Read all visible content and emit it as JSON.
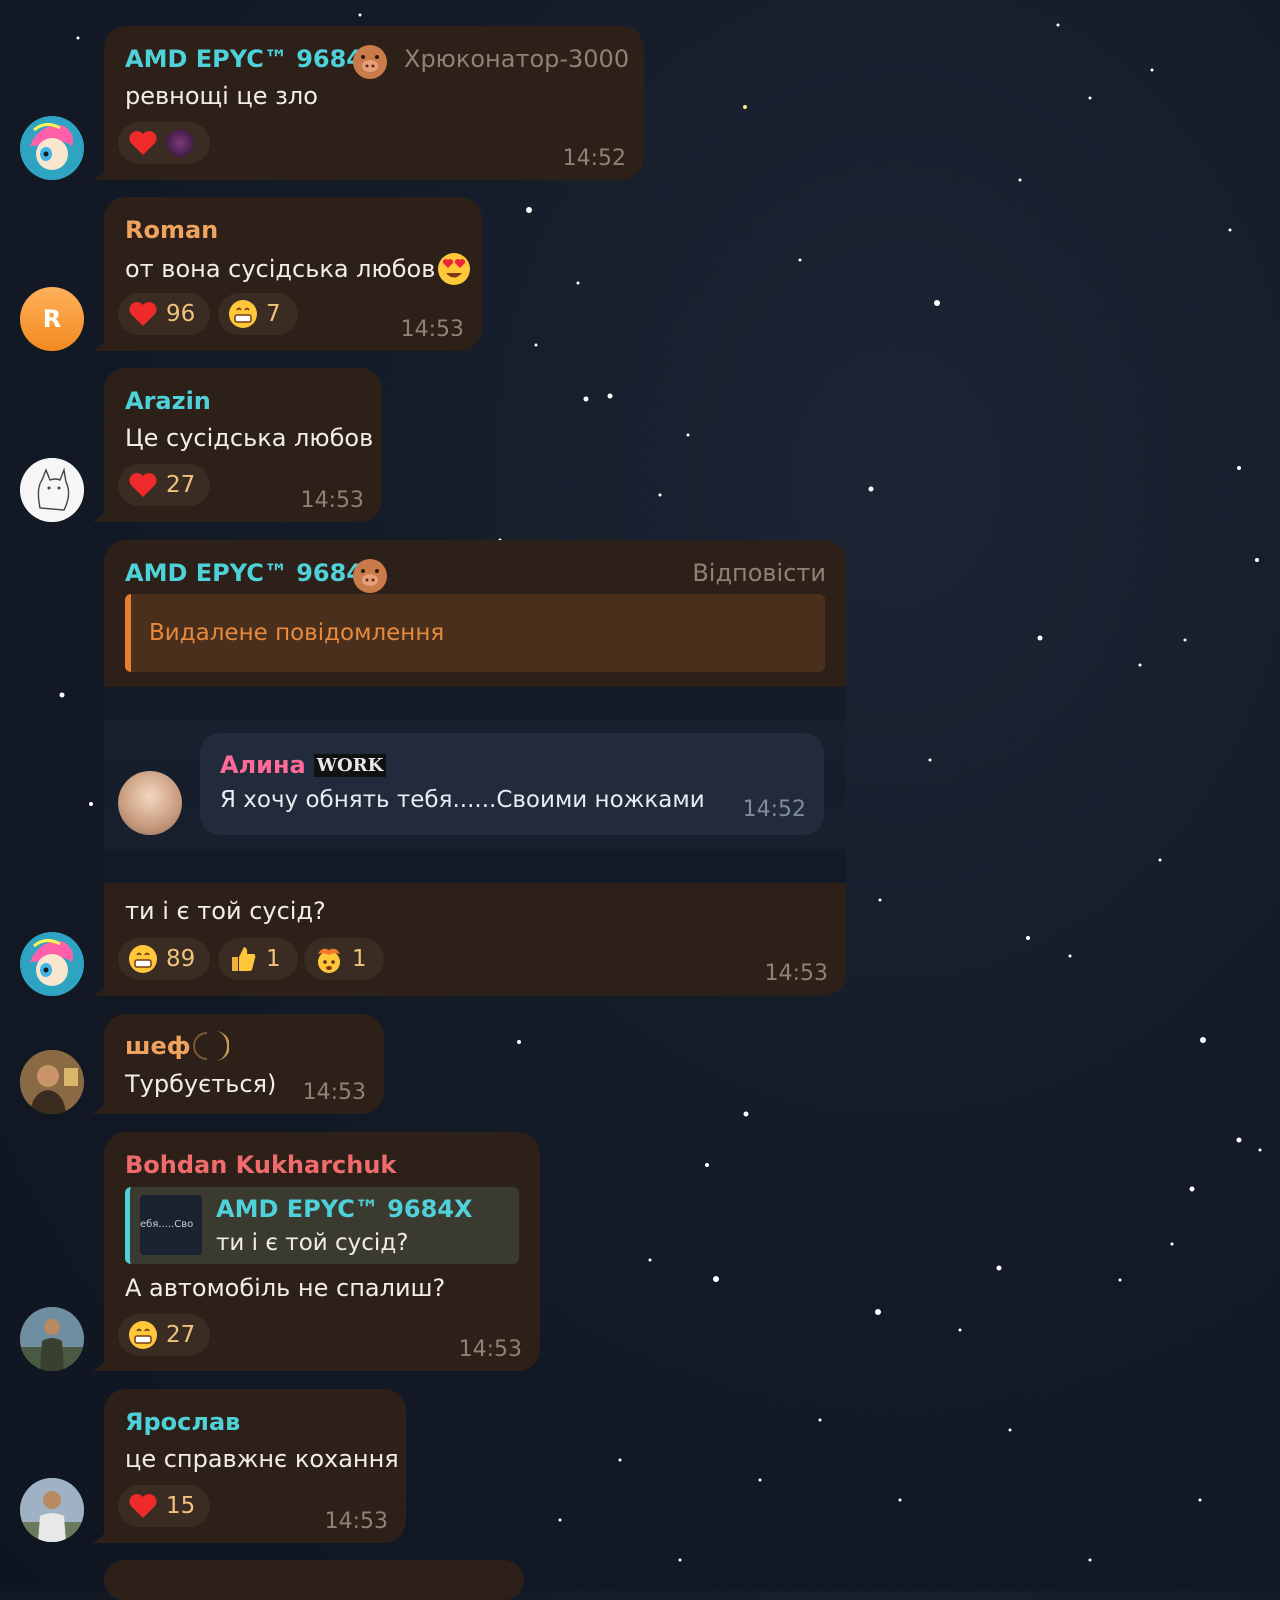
{
  "messages": [
    {
      "sender": "AMD EPYC™ 9684X",
      "sender_badge": "pig-emoji",
      "title_tag": "Хрюконатор-3000",
      "text": "ревнощі це зло",
      "time": "14:52",
      "reactions": [
        {
          "emoji": "red-heart",
          "reactor_avatar": "avatar-icon"
        }
      ]
    },
    {
      "sender": "Roman",
      "avatar_letter": "R",
      "text": "от вона сусідська любов",
      "text_emoji": "heart-eyes",
      "time": "14:53",
      "reactions": [
        {
          "emoji": "red-heart",
          "count": "96"
        },
        {
          "emoji": "grin",
          "count": "7"
        }
      ]
    },
    {
      "sender": "Arazin",
      "text": "Це сусідська любов",
      "time": "14:53",
      "reactions": [
        {
          "emoji": "red-heart",
          "count": "27"
        }
      ]
    },
    {
      "sender": "AMD EPYC™ 9684X",
      "sender_badge": "pig-emoji",
      "reply_action": "Відповісти",
      "reply_preview": "Видалене повідомлення",
      "embedded": {
        "sender": "Алина",
        "sender_badge": "WORK",
        "text": "Я хочу обнять тебя......Своими ножками",
        "time": "14:52"
      },
      "text": "ти і є той сусід?",
      "time": "14:53",
      "reactions": [
        {
          "emoji": "grin",
          "count": "89"
        },
        {
          "emoji": "thumbs-up",
          "count": "1"
        },
        {
          "emoji": "exploding-head",
          "count": "1"
        }
      ]
    },
    {
      "sender": "шеф",
      "sender_badge": "moon",
      "text": "Турбується)",
      "time": "14:53"
    },
    {
      "sender": "Bohdan Kukharchuk",
      "quote": {
        "sender": "AMD EPYC™ 9684X",
        "text": "ти і є той сусід?",
        "thumb_text": "ебя.....Сво"
      },
      "text": "А автомобіль не спалиш?",
      "time": "14:53",
      "reactions": [
        {
          "emoji": "grin",
          "count": "27"
        }
      ]
    },
    {
      "sender": "Ярослав",
      "text": "це справжнє кохання",
      "time": "14:53",
      "reactions": [
        {
          "emoji": "red-heart",
          "count": "15"
        }
      ]
    }
  ],
  "colors": {
    "bubble": "#2c2019",
    "reaction_bg": "#3a2c22",
    "accent_cyan": "#4fd1d9",
    "accent_orange": "#f0a35e",
    "accent_red": "#f06b6b",
    "accent_pink": "#ff6b96",
    "time": "#8e8175",
    "background": "#141b28"
  }
}
